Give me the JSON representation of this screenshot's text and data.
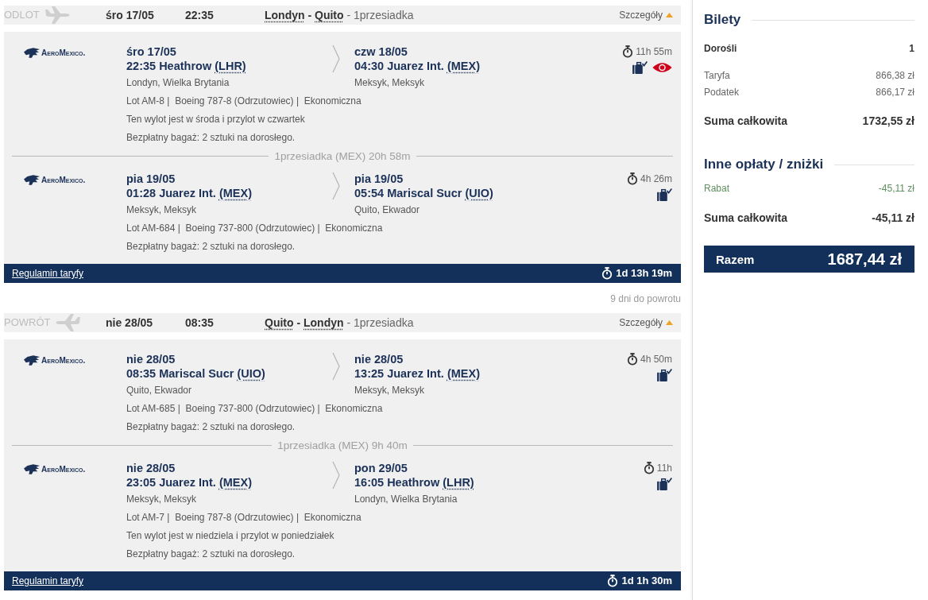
{
  "journeys": [
    {
      "kind": "outbound",
      "label": "ODLOT",
      "date": "śro 17/05",
      "time": "22:35",
      "origin": "Londyn",
      "separator": "-",
      "destination": "Quito",
      "stops": "- 1przesiadka",
      "details_link": "Szczegóły",
      "expanded": true,
      "legs": [
        {
          "kind": "flight",
          "airline": "AeroMexico.",
          "departure": {
            "date": "śro 17/05",
            "time": "22:35",
            "airport": "Heathrow",
            "code": "(LHR)",
            "city": "Londyn, Wielka Brytania"
          },
          "arrival": {
            "date": "czw 18/05",
            "time": "04:30",
            "airport": "Juarez Int.",
            "code": "(MEX)",
            "city": "Meksyk, Meksyk"
          },
          "details": "Lot AM-8 |  Boeing 787-8 (Odrzutowiec) |  Ekonomiczna",
          "note": "Ten wylot jest w środa i przylot w czwartek",
          "baggage": "Bezpłatny bagaż: 2 sztuki na dorosłego.",
          "duration": "11h 55m",
          "flagged": true
        },
        {
          "kind": "layover",
          "text": "1przesiadka (MEX) 20h 58m"
        },
        {
          "kind": "flight",
          "airline": "AeroMexico.",
          "departure": {
            "date": "pia 19/05",
            "time": "01:28",
            "airport": "Juarez Int.",
            "code": "(MEX)",
            "city": "Meksyk, Meksyk"
          },
          "arrival": {
            "date": "pia 19/05",
            "time": "05:54",
            "airport": "Mariscal Sucr",
            "code": "(UIO)",
            "city": "Quito, Ekwador"
          },
          "details": "Lot AM-684 |  Boeing 737-800 (Odrzutowiec) |  Ekonomiczna",
          "baggage": "Bezpłatny bagaż: 2 sztuki na dorosłego.",
          "duration": "4h 26m",
          "flagged": false
        }
      ],
      "fare_rules_link": "Regulamin taryfy",
      "total_duration": "1d 13h 19m"
    },
    {
      "kind": "return",
      "gap_note": "9 dni do powrotu",
      "label": "POWRÓT",
      "date": "nie 28/05",
      "time": "08:35",
      "origin": "Quito",
      "separator": "-",
      "destination": "Londyn",
      "stops": "- 1przesiadka",
      "details_link": "Szczegóły",
      "expanded": true,
      "legs": [
        {
          "kind": "flight",
          "airline": "AeroMexico.",
          "departure": {
            "date": "nie 28/05",
            "time": "08:35",
            "airport": "Mariscal Sucr",
            "code": "(UIO)",
            "city": "Quito, Ekwador"
          },
          "arrival": {
            "date": "nie 28/05",
            "time": "13:25",
            "airport": "Juarez Int.",
            "code": "(MEX)",
            "city": "Meksyk, Meksyk"
          },
          "details": "Lot AM-685 |  Boeing 737-800 (Odrzutowiec) |  Ekonomiczna",
          "baggage": "Bezpłatny bagaż: 2 sztuki na dorosłego.",
          "duration": "4h 50m",
          "flagged": false
        },
        {
          "kind": "layover",
          "text": "1przesiadka (MEX) 9h 40m"
        },
        {
          "kind": "flight",
          "airline": "AeroMexico.",
          "departure": {
            "date": "nie 28/05",
            "time": "23:05",
            "airport": "Juarez Int.",
            "code": "(MEX)",
            "city": "Meksyk, Meksyk"
          },
          "arrival": {
            "date": "pon 29/05",
            "time": "16:05",
            "airport": "Heathrow",
            "code": "(LHR)",
            "city": "Londyn, Wielka Brytania"
          },
          "details": "Lot AM-7 |  Boeing 787-8 (Odrzutowiec) |  Ekonomiczna",
          "note": "Ten wylot jest w niedziela i przylot w poniedziałek",
          "baggage": "Bezpłatny bagaż: 2 sztuki na dorosłego.",
          "duration": "11h",
          "flagged": false
        }
      ],
      "fare_rules_link": "Regulamin taryfy",
      "total_duration": "1d 1h 30m"
    }
  ],
  "summary": {
    "title": "Bilety",
    "passenger": {
      "label": "Dorośli",
      "count": "1"
    },
    "items": [
      {
        "kind": "fee",
        "label": "Taryfa",
        "amount": "866,38 zł"
      },
      {
        "kind": "fee",
        "label": "Podatek",
        "amount": "866,17 zł"
      }
    ],
    "subtotal": {
      "label": "Suma całkowita",
      "amount": "1732,55 zł"
    },
    "extras": {
      "title": "Inne opłaty / zniżki",
      "items": [
        {
          "kind": "discount",
          "label": "Rabat",
          "amount": "-45,11 zł"
        }
      ],
      "subtotal": {
        "label": "Suma całkowita",
        "amount": "-45,11 zł"
      }
    },
    "total": {
      "label": "Razem",
      "amount": "1687,44 zł"
    }
  }
}
